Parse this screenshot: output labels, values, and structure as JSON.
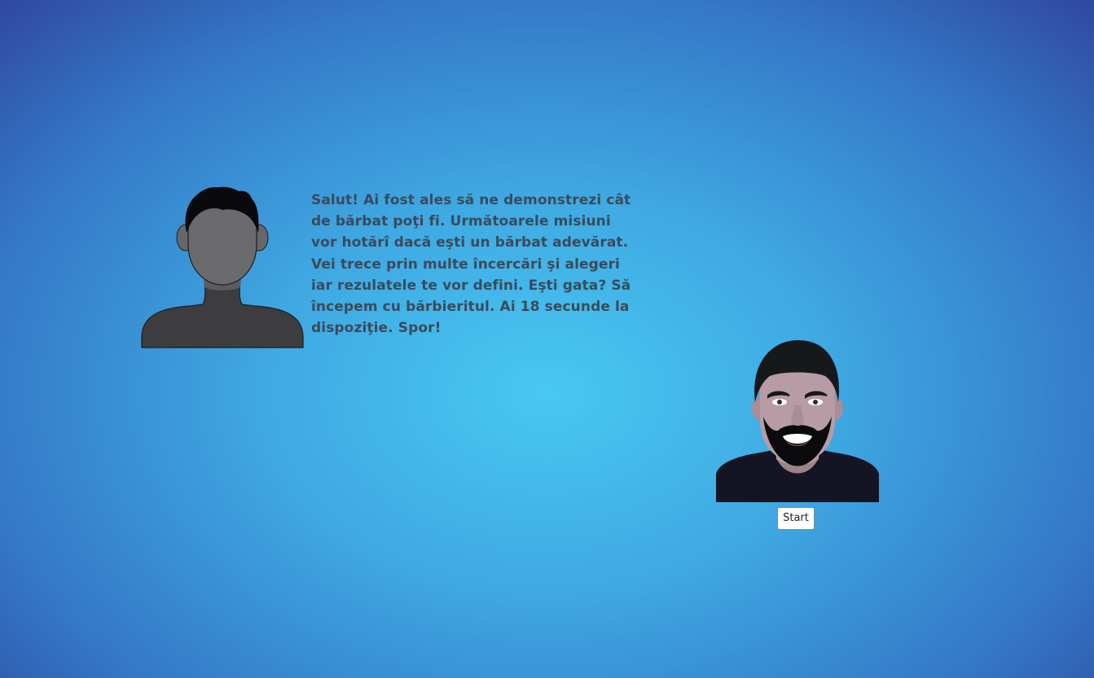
{
  "scene": {
    "narrator_avatar": "silhouette-avatar",
    "dialog_text": "Salut! Ai fost ales să ne demonstrezi cât de bărbat poţi fi. Următoarele misiuni vor hotărî dacă eşti un bărbat adevărat. Vei trece prin multe încercări şi alegeri iar rezulatele te vor defini. Eşti gata? Să începem cu bărbieritul. Ai 18 secunde la dispoziţie. Spor!",
    "player_avatar": "bearded-man-avatar",
    "start_button_label": "Start"
  },
  "colors": {
    "background_center": "#48c8f2",
    "background_edge": "#2f3f98",
    "text": "#3b4a5a"
  }
}
